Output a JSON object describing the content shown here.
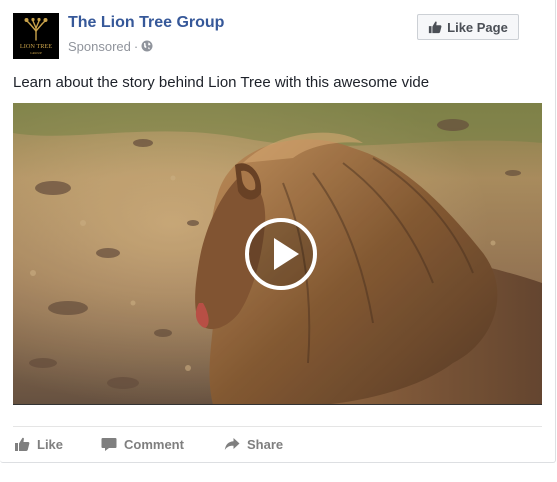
{
  "post": {
    "page_name": "The Lion Tree Group",
    "sponsored_label": "Sponsored",
    "separator": "·",
    "text": "Learn about the story behind Lion Tree with this awesome vide",
    "avatar": {
      "logo_text": "LION TREE",
      "logo_subtext": "GROUP"
    }
  },
  "header": {
    "like_page_label": "Like Page"
  },
  "video": {
    "state": "paused",
    "icon": "play-icon"
  },
  "actions": [
    {
      "label": "Like",
      "icon": "thumbs-up-icon"
    },
    {
      "label": "Comment",
      "icon": "comment-icon"
    },
    {
      "label": "Share",
      "icon": "share-icon"
    }
  ],
  "colors": {
    "link_blue": "#365899",
    "meta_gray": "#90949c",
    "action_gray": "#7f7f7f",
    "logo_gold": "#c9a24a"
  }
}
